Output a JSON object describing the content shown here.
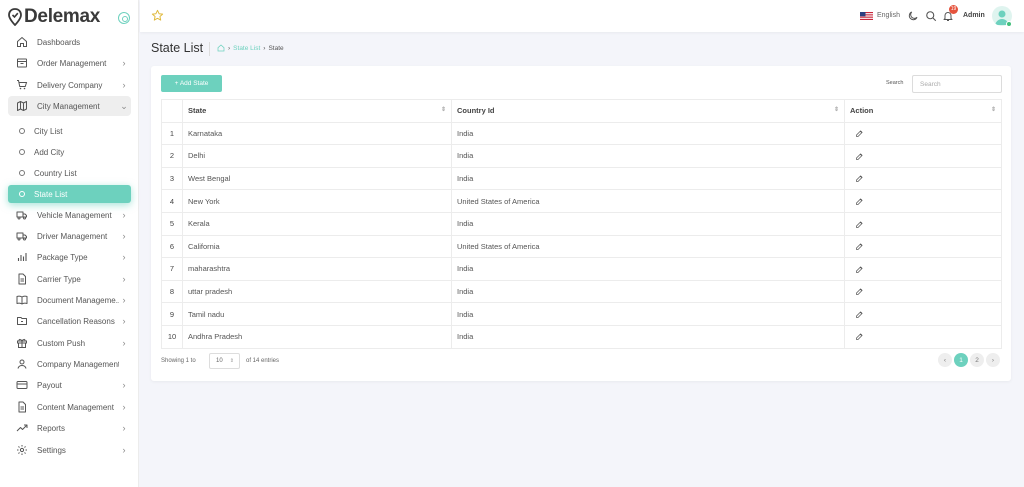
{
  "brand": {
    "name": "Delemax",
    "accent": "#6dd1be"
  },
  "sidebar": {
    "items": [
      {
        "label": "Dashboards",
        "icon": "home-icon",
        "chevron": ""
      },
      {
        "label": "Order Management",
        "icon": "inbox-icon",
        "chevron": "›"
      },
      {
        "label": "Delivery Company",
        "icon": "cart-icon",
        "chevron": "›"
      },
      {
        "label": "City Management",
        "icon": "map-icon",
        "chevron": "⌄"
      },
      {
        "label": "Vehicle Management",
        "icon": "truck-icon",
        "chevron": "›"
      },
      {
        "label": "Driver Management",
        "icon": "truck-icon",
        "chevron": "›"
      },
      {
        "label": "Package Type",
        "icon": "bars-icon",
        "chevron": "›"
      },
      {
        "label": "Carrier Type",
        "icon": "file-icon",
        "chevron": "›"
      },
      {
        "label": "Document Manageme...",
        "icon": "book-icon",
        "chevron": "›"
      },
      {
        "label": "Cancellation Reasons",
        "icon": "folder-icon",
        "chevron": "›"
      },
      {
        "label": "Custom Push",
        "icon": "gift-icon",
        "chevron": "›"
      },
      {
        "label": "Company Management",
        "icon": "user-icon",
        "chevron": ""
      },
      {
        "label": "Payout",
        "icon": "card-icon",
        "chevron": "›"
      },
      {
        "label": "Content Management",
        "icon": "file-icon",
        "chevron": "›"
      },
      {
        "label": "Reports",
        "icon": "trend-icon",
        "chevron": "›"
      },
      {
        "label": "Settings",
        "icon": "gear-icon",
        "chevron": "›"
      }
    ],
    "sub_items": [
      {
        "label": "City List"
      },
      {
        "label": "Add City"
      },
      {
        "label": "Country List"
      },
      {
        "label": "State List"
      }
    ]
  },
  "topbar": {
    "language": "English",
    "notification_count": "19",
    "user_name": "Admin"
  },
  "page": {
    "title": "State List",
    "breadcrumb": {
      "current_link": "State List",
      "leaf": "State"
    }
  },
  "toolbar": {
    "add_label": "+ Add State",
    "search_label": "Search",
    "search_placeholder": "Search"
  },
  "table": {
    "headers": {
      "state": "State",
      "country": "Country Id",
      "action": "Action"
    },
    "rows": [
      {
        "num": "1",
        "state": "Karnataka",
        "country": "India"
      },
      {
        "num": "2",
        "state": "Delhi",
        "country": "India"
      },
      {
        "num": "3",
        "state": "West Bengal",
        "country": "India"
      },
      {
        "num": "4",
        "state": "New York",
        "country": "United States of America"
      },
      {
        "num": "5",
        "state": "Kerala",
        "country": "India"
      },
      {
        "num": "6",
        "state": "California",
        "country": "United States of America"
      },
      {
        "num": "7",
        "state": "maharashtra",
        "country": "India"
      },
      {
        "num": "8",
        "state": "uttar pradesh",
        "country": "India"
      },
      {
        "num": "9",
        "state": "Tamil nadu",
        "country": "India"
      },
      {
        "num": "10",
        "state": "Andhra Pradesh",
        "country": "India"
      }
    ]
  },
  "footer": {
    "showing_prefix": "Showing 1 to",
    "per_page": "10",
    "entries_suffix": "of 14 entries",
    "pages": [
      "1",
      "2"
    ],
    "prev": "‹",
    "next": "›"
  }
}
